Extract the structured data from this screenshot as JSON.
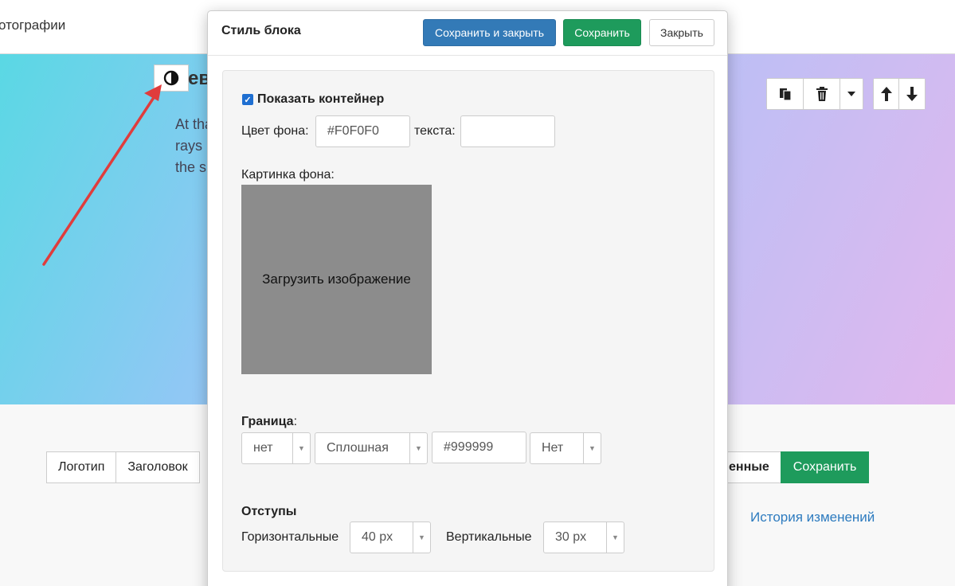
{
  "topbar": {
    "crumb": "отографии"
  },
  "hero": {
    "title": "ев",
    "text_lines": [
      "At tha",
      "rays",
      "the s"
    ]
  },
  "modal": {
    "title": "Стиль блока",
    "save_close": "Сохранить и закрыть",
    "save": "Сохранить",
    "close": "Закрыть",
    "show_container": "Показать контейнер",
    "bg_color_label": "Цвет фона:",
    "bg_color_value": "#F0F0F0",
    "text_color_label": "текста:",
    "text_color_value": "",
    "bg_image_label": "Картинка фона:",
    "upload_label": "Загрузить изображение",
    "border_label": "Граница",
    "border_colon": ":",
    "border_width": "нет",
    "border_style": "Сплошная",
    "border_color": "#999999",
    "border_radius": "Нет",
    "padding_label": "Отступы",
    "horizontal_label": "Горизонтальные",
    "horizontal_value": "40 px",
    "vertical_label": "Вертикальные",
    "vertical_value": "30 px"
  },
  "bottom": {
    "tabs": [
      "Логотип",
      "Заголовок"
    ],
    "saved_label": "енные",
    "save_label": "Сохранить",
    "history": "История изменений"
  },
  "colors": {
    "primary": "#337ab7",
    "success": "#1e9b5c",
    "arrow": "#e03c3c",
    "link": "#2d7bbf"
  }
}
